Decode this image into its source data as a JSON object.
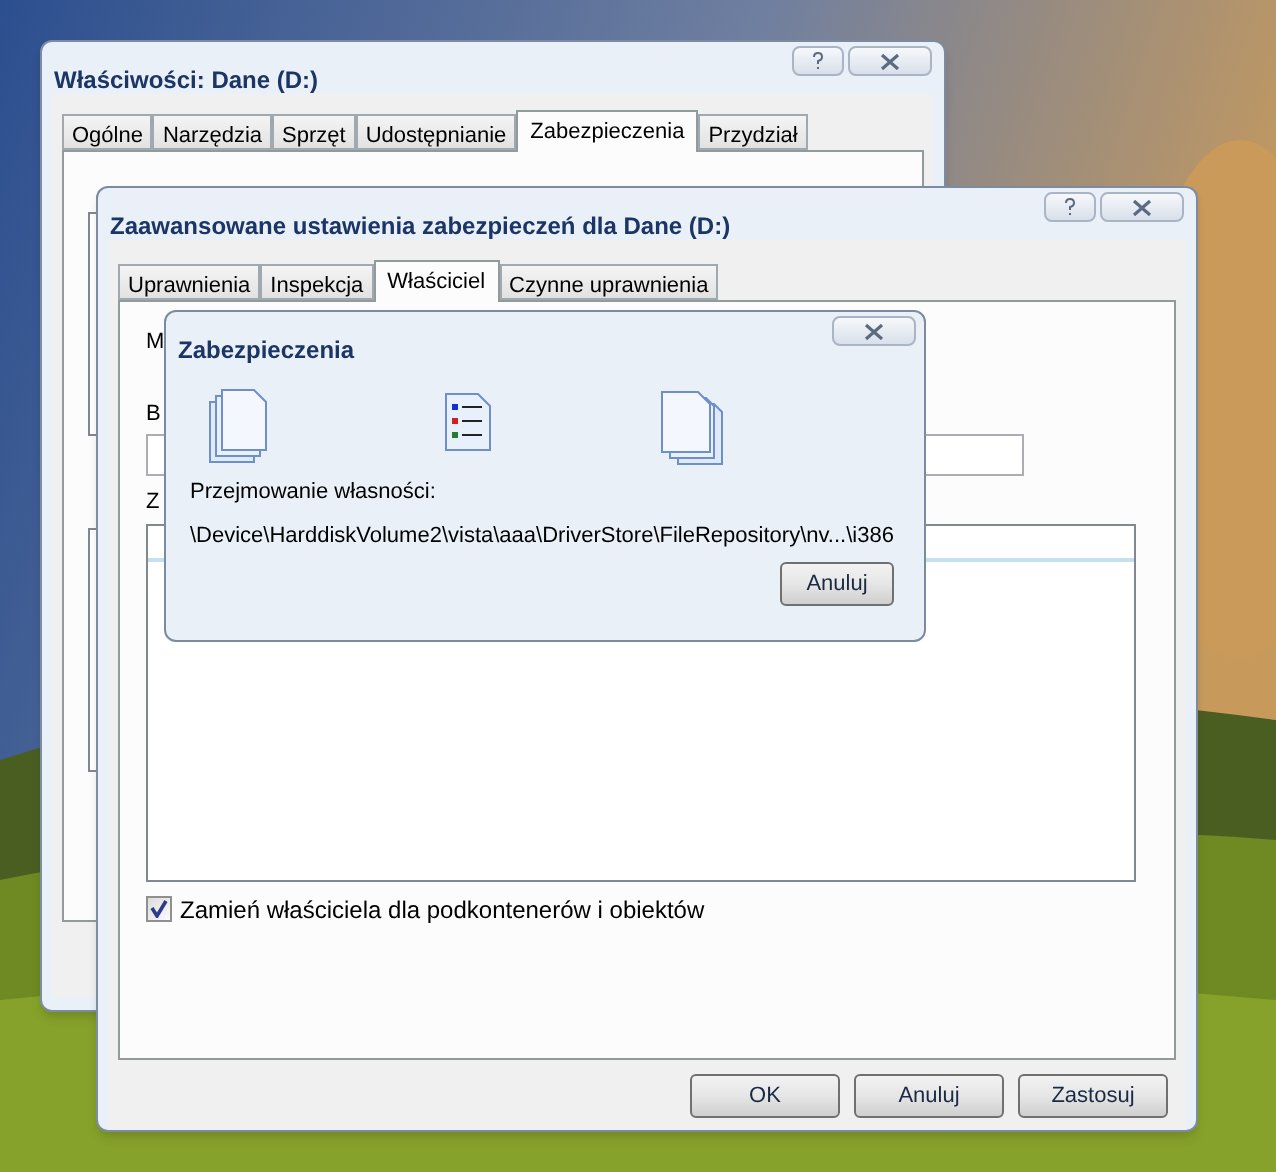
{
  "back_window": {
    "title": "Właściwości: Dane (D:)",
    "tabs": [
      {
        "label": "Ogólne",
        "selected": false
      },
      {
        "label": "Narzędzia",
        "selected": false
      },
      {
        "label": "Sprzęt",
        "selected": false
      },
      {
        "label": "Udostępnianie",
        "selected": false
      },
      {
        "label": "Zabezpieczenia",
        "selected": true
      },
      {
        "label": "Przydział",
        "selected": false
      }
    ]
  },
  "front_window": {
    "title": "Zaawansowane ustawienia zabezpieczeń dla Dane (D:)",
    "tabs": [
      {
        "label": "Uprawnienia",
        "selected": false
      },
      {
        "label": "Inspekcja",
        "selected": false
      },
      {
        "label": "Właściciel",
        "selected": true
      },
      {
        "label": "Czynne uprawnienia",
        "selected": false
      }
    ],
    "first_label": "M",
    "second_label": "B",
    "third_label": "Z",
    "checkbox": {
      "label": "Zamień właściciela dla podkontenerów i obiektów",
      "checked": true
    },
    "buttons": [
      "OK",
      "Anuluj",
      "Zastosuj"
    ]
  },
  "progress_dialog": {
    "title": "Zabezpieczenia",
    "label": "Przejmowanie własności:",
    "path": "\\Device\\HarddiskVolume2\\vista\\aaa\\DriverStore\\FileRepository\\nv...\\i386",
    "button": "Anuluj"
  }
}
